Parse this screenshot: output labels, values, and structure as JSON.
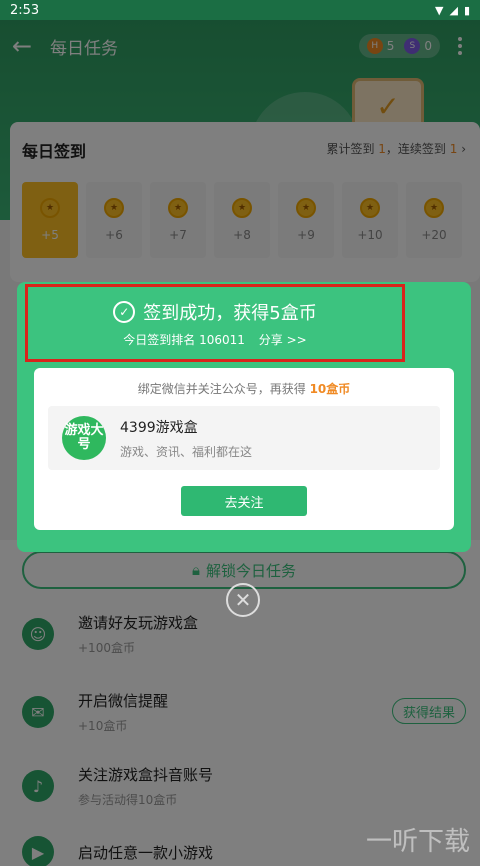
{
  "status_bar": {
    "time": "2:53",
    "icons": [
      "wifi-icon",
      "signal-icon",
      "battery-icon"
    ]
  },
  "topbar": {
    "title": "每日任务",
    "coins": [
      {
        "icon": "H",
        "value": "5"
      },
      {
        "icon": "S",
        "value": "0"
      }
    ]
  },
  "checkin": {
    "title": "每日签到",
    "stat_prefix": "累计签到 ",
    "total": "1",
    "stat_mid": "，连续签到 ",
    "streak": "1",
    "stat_suffix": " ›",
    "days": [
      "+5",
      "+6",
      "+7",
      "+8",
      "+9",
      "+10",
      "+20"
    ]
  },
  "modal": {
    "success": "签到成功，获得5盒币",
    "rank_text": "今日签到排名 106011",
    "share": "分享 >>",
    "bind_tip": "绑定微信并关注公众号，再获得 ",
    "bind_reward": "10盒币",
    "promo_logo": "游戏大号",
    "promo_name": "4399游戏盒",
    "promo_desc": "游戏、资讯、福利都在这",
    "follow": "去关注"
  },
  "tasks": {
    "unlock": "解锁今日任务",
    "items": [
      {
        "name": "邀请好友玩游戏盒",
        "sub": "+100盒币"
      },
      {
        "name": "开启微信提醒",
        "sub": "+10盒币",
        "btn": "获得结果"
      },
      {
        "name": "关注游戏盒抖音账号",
        "sub": "参与活动得10盒币"
      },
      {
        "name": "启动任意一款小游戏",
        "sub": ""
      }
    ]
  },
  "watermark": "一听下载",
  "colors": {
    "primary": "#3cc37f",
    "header": "#2f9d62",
    "highlight_border": "#d9241b",
    "coin": "#ffc125"
  }
}
